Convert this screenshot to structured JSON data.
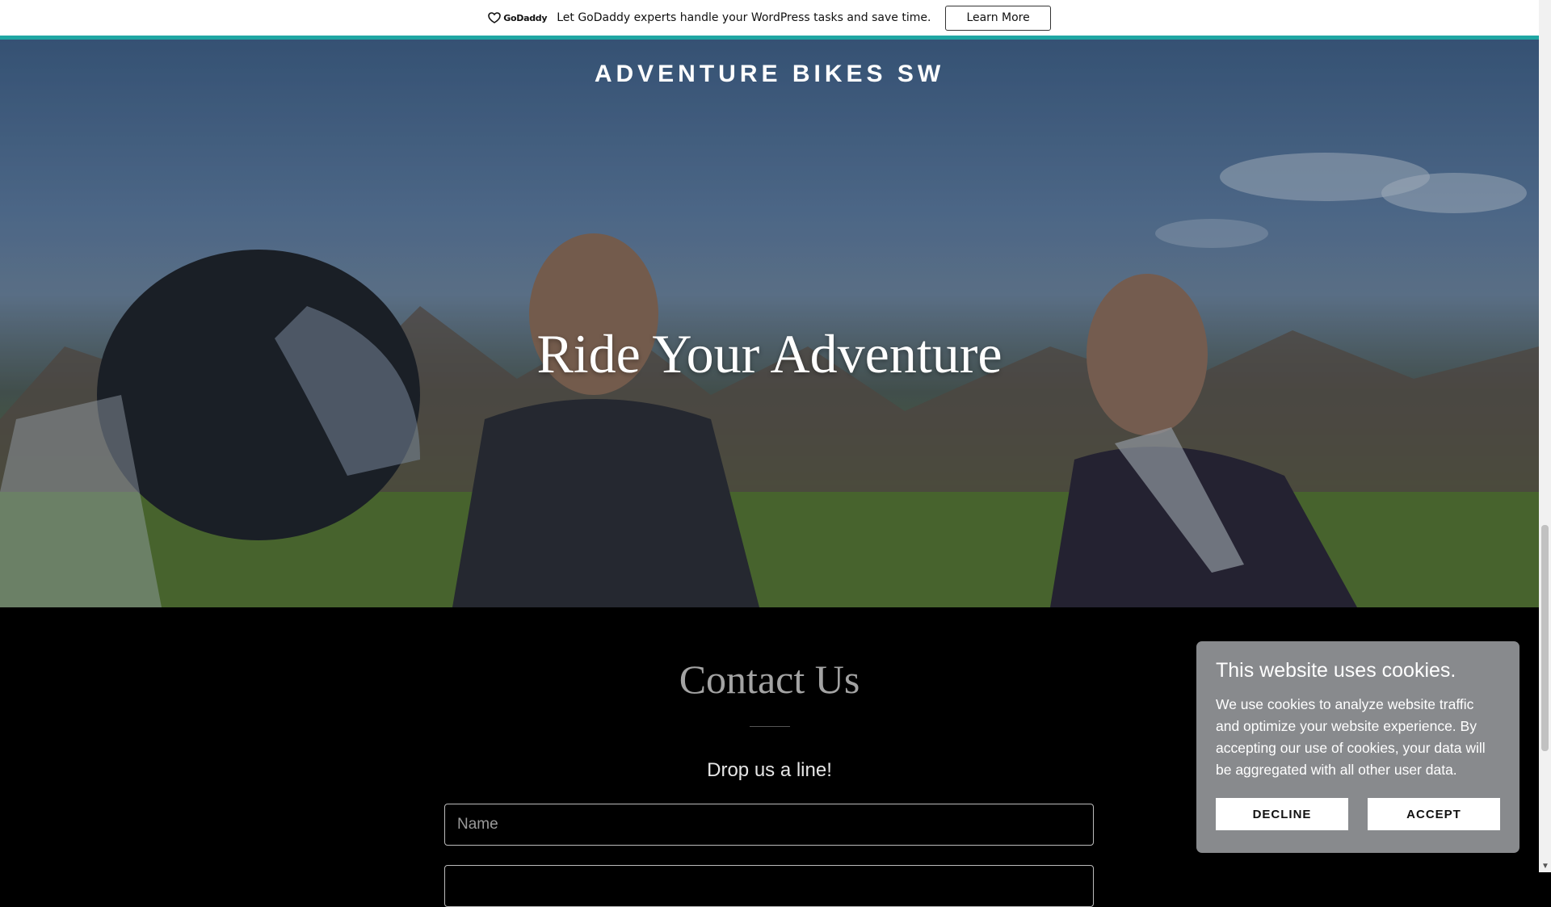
{
  "promo": {
    "logo_text": "GoDaddy",
    "text": "Let GoDaddy experts handle your WordPress tasks and save time.",
    "button_label": "Learn More"
  },
  "header": {
    "site_title": "ADVENTURE BIKES SW"
  },
  "hero": {
    "title": "Ride Your Adventure"
  },
  "contact": {
    "heading": "Contact Us",
    "subheading": "Drop us a line!",
    "name_placeholder": "Name",
    "email_placeholder": ""
  },
  "cookie_banner": {
    "title": "This website uses cookies.",
    "text": "We use cookies to analyze website traffic and optimize your website experience. By accepting our use of cookies, your data will be aggregated with all other user data.",
    "decline_label": "DECLINE",
    "accept_label": "ACCEPT"
  },
  "colors": {
    "promo_border": "#1fa6a3",
    "page_background": "#000000",
    "cookie_background": "#888a8d"
  }
}
